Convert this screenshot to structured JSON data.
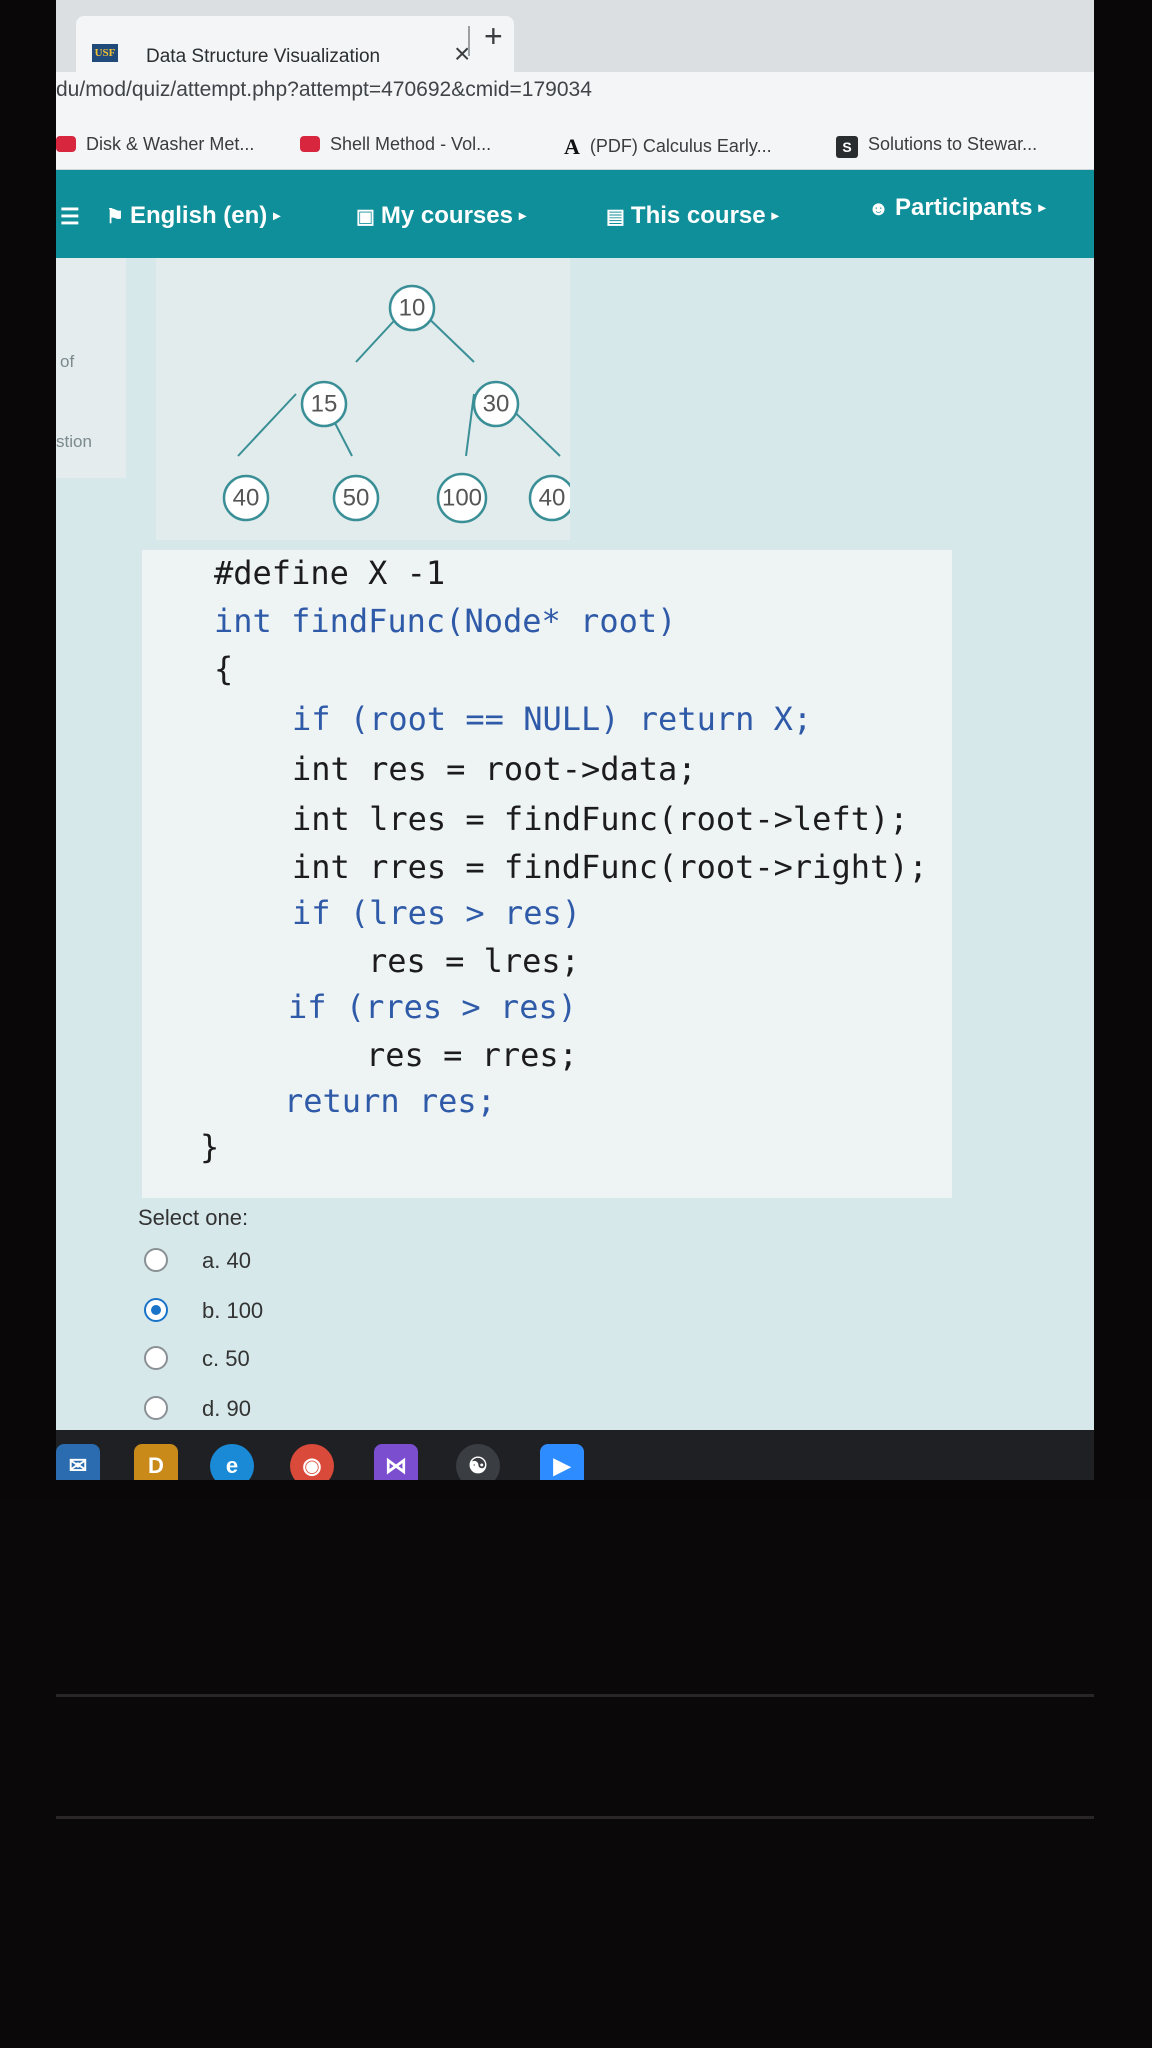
{
  "browser": {
    "tab_title": "Data Structure Visualization",
    "tab_close": "×",
    "new_tab": "+",
    "favicon_text": "USF",
    "url": "du/mod/quiz/attempt.php?attempt=470692&cmid=179034",
    "bookmarks": [
      {
        "label": "Disk & Washer Met...",
        "icon": "video-icon"
      },
      {
        "label": "Shell Method - Vol...",
        "icon": "video-icon"
      },
      {
        "label": "(PDF) Calculus Early...",
        "icon_text": "A"
      },
      {
        "label": "Solutions to Stewar...",
        "icon_text": "S"
      }
    ]
  },
  "navbar": {
    "items": [
      {
        "label": "English (en)",
        "icon": "flag-icon"
      },
      {
        "label": "My courses",
        "icon": "briefcase-icon"
      },
      {
        "label": "This course",
        "icon": "book-icon"
      },
      {
        "label": "Participants",
        "icon": "people-icon"
      }
    ],
    "menu_glyph": "☰",
    "caret": "▸",
    "accent": "#0f8f99"
  },
  "drawer": {
    "text_1": "of",
    "text_2": "stion"
  },
  "tree": {
    "nodes": [
      "10",
      "15",
      "30",
      "40",
      "50",
      "100",
      "40"
    ],
    "stroke_color": "#3a8f96"
  },
  "code": {
    "lines": [
      "#define X -1",
      "int findFunc(Node* root)",
      "{",
      "if (root == NULL) return X;",
      "int res = root->data;",
      "int lres = findFunc(root->left);",
      "int rres = findFunc(root->right);",
      "if (lres > res)",
      "res = lres;",
      "if (rres > res)",
      "res = rres;",
      "return res;",
      "}"
    ]
  },
  "question": {
    "select_prompt": "Select one:",
    "options": [
      {
        "label": "a. 40",
        "checked": false
      },
      {
        "label": "b. 100",
        "checked": true
      },
      {
        "label": "c. 50",
        "checked": false
      },
      {
        "label": "d. 90",
        "checked": false
      }
    ]
  },
  "taskbar": {
    "apps": [
      {
        "name": "mail-app",
        "glyph": "✉",
        "color": "#2b6cb0"
      },
      {
        "name": "dell-app",
        "glyph": "D",
        "color": "#c98a1a"
      },
      {
        "name": "edge-browser",
        "glyph": "e",
        "color": "#1b8ad6"
      },
      {
        "name": "chrome-browser",
        "glyph": "◉",
        "color": "#d94a3a"
      },
      {
        "name": "visual-studio",
        "glyph": "⋈",
        "color": "#7b4ed0"
      },
      {
        "name": "steam-app",
        "glyph": "☯",
        "color": "#3a3d42"
      },
      {
        "name": "zoom-app",
        "glyph": "▶",
        "color": "#2d8cff"
      }
    ]
  }
}
